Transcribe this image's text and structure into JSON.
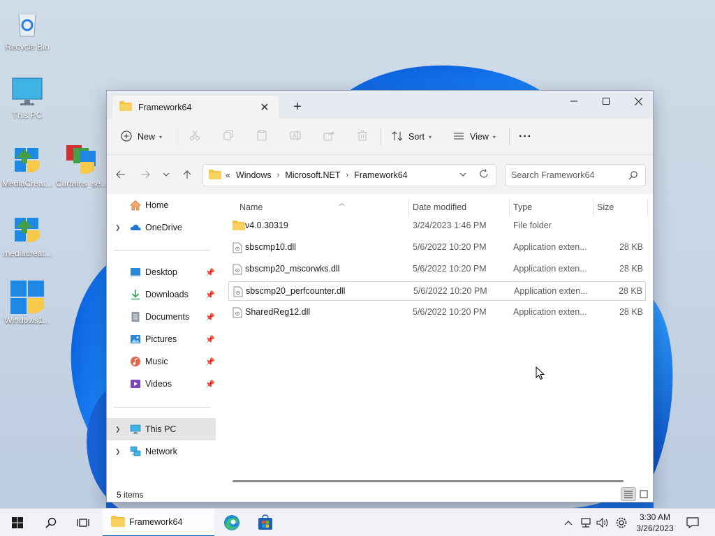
{
  "desktop": {
    "icons": [
      {
        "label": "Recycle Bin"
      },
      {
        "label": "This PC"
      },
      {
        "label": "MediaCreat..."
      },
      {
        "label": "Curtains_se..."
      },
      {
        "label": "mediacreat..."
      },
      {
        "label": "Windows1..."
      }
    ]
  },
  "window": {
    "tab_title": "Framework64",
    "toolbar": {
      "new_label": "New",
      "sort_label": "Sort",
      "view_label": "View",
      "more_label": "···"
    },
    "address": {
      "overflow": "«",
      "crumbs": [
        "Windows",
        "Microsoft.NET",
        "Framework64"
      ]
    },
    "search": {
      "placeholder": "Search Framework64"
    },
    "nav": {
      "home": "Home",
      "onedrive": "OneDrive",
      "desktop": "Desktop",
      "downloads": "Downloads",
      "documents": "Documents",
      "pictures": "Pictures",
      "music": "Music",
      "videos": "Videos",
      "thispc": "This PC",
      "network": "Network"
    },
    "columns": {
      "name": "Name",
      "date": "Date modified",
      "type": "Type",
      "size": "Size"
    },
    "files": [
      {
        "name": "v4.0.30319",
        "date": "3/24/2023 1:46 PM",
        "type": "File folder",
        "size": ""
      },
      {
        "name": "sbscmp10.dll",
        "date": "5/6/2022 10:20 PM",
        "type": "Application exten...",
        "size": "28 KB"
      },
      {
        "name": "sbscmp20_mscorwks.dll",
        "date": "5/6/2022 10:20 PM",
        "type": "Application exten...",
        "size": "28 KB"
      },
      {
        "name": "sbscmp20_perfcounter.dll",
        "date": "5/6/2022 10:20 PM",
        "type": "Application exten...",
        "size": "28 KB"
      },
      {
        "name": "SharedReg12.dll",
        "date": "5/6/2022 10:20 PM",
        "type": "Application exten...",
        "size": "28 KB"
      }
    ],
    "status": {
      "item_count": "5 items"
    }
  },
  "taskbar": {
    "app_label": "Framework64",
    "time": "3:30 AM",
    "date": "3/26/2023"
  },
  "colors": {
    "accent": "#0067c0",
    "folder": "#f6c343",
    "selection": "#e5e5e5"
  }
}
